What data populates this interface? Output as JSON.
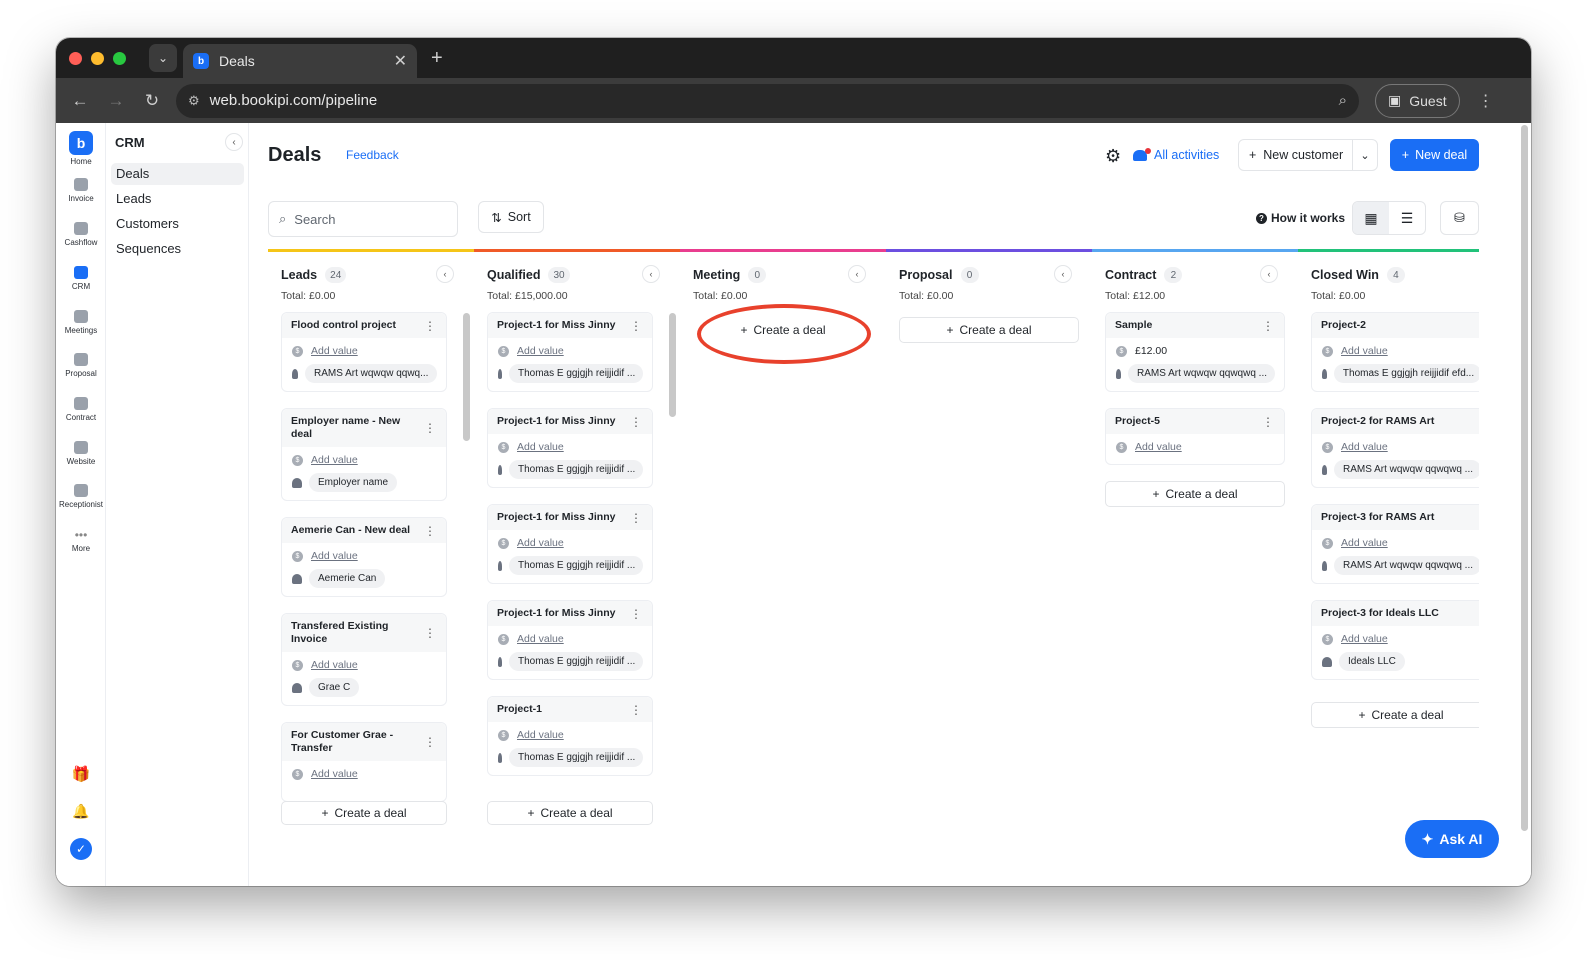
{
  "browser": {
    "tab_title": "Deals",
    "url": "web.bookipi.com/pipeline",
    "profile": "Guest"
  },
  "rail": [
    {
      "label": "Home",
      "icon": "home-logo-icon"
    },
    {
      "label": "Invoice",
      "icon": "invoice-icon"
    },
    {
      "label": "Cashflow",
      "icon": "cashflow-icon"
    },
    {
      "label": "CRM",
      "icon": "crm-icon"
    },
    {
      "label": "Meetings",
      "icon": "meetings-icon"
    },
    {
      "label": "Proposal",
      "icon": "proposal-icon"
    },
    {
      "label": "Contract",
      "icon": "contract-icon"
    },
    {
      "label": "Website",
      "icon": "website-icon"
    },
    {
      "label": "Receptionist",
      "icon": "receptionist-icon"
    },
    {
      "label": "More",
      "icon": "more-icon"
    }
  ],
  "subnav": {
    "title": "CRM",
    "items": [
      "Deals",
      "Leads",
      "Customers",
      "Sequences"
    ]
  },
  "header": {
    "title": "Deals",
    "feedback": "Feedback",
    "all_activities": "All activities",
    "new_customer": "New customer",
    "new_deal": "New deal"
  },
  "toolbar": {
    "search_placeholder": "Search",
    "sort": "Sort",
    "how_it_works": "How it works"
  },
  "colors": {
    "accent": "#1a6ef5",
    "leads": "#f5c518",
    "qualified": "#f05a28",
    "meeting": "#e93d8f",
    "proposal": "#6c4fe0",
    "contract": "#57a6f0",
    "closed_win": "#22c27a",
    "highlight": "#e8412c"
  },
  "columns": [
    {
      "name": "Leads",
      "count": "24",
      "total": "Total: £0.00",
      "cards": [
        {
          "title": "Flood control project",
          "value": "Add value",
          "who": "RAMS Art wqwqw qqwq..."
        },
        {
          "title": "Employer name - New deal",
          "value": "Add value",
          "who": "Employer name"
        },
        {
          "title": "Aemerie Can - New deal",
          "value": "Add value",
          "who": "Aemerie Can"
        },
        {
          "title": "Transfered Existing Invoice",
          "value": "Add value",
          "who": "Grae C"
        },
        {
          "title": "For Customer Grae - Transfer",
          "value": "Add value",
          "who": ""
        }
      ],
      "create": "Create a deal"
    },
    {
      "name": "Qualified",
      "count": "30",
      "total": "Total: £15,000.00",
      "cards": [
        {
          "title": "Project-1 for Miss Jinny",
          "value": "Add value",
          "who": "Thomas E ggjgjh reijjidif ..."
        },
        {
          "title": "Project-1 for Miss Jinny",
          "value": "Add value",
          "who": "Thomas E ggjgjh reijjidif ..."
        },
        {
          "title": "Project-1 for Miss Jinny",
          "value": "Add value",
          "who": "Thomas E ggjgjh reijjidif ..."
        },
        {
          "title": "Project-1 for Miss Jinny",
          "value": "Add value",
          "who": "Thomas E ggjgjh reijjidif ..."
        },
        {
          "title": "Project-1",
          "value": "Add value",
          "who": "Thomas E ggjgjh reijjidif ..."
        }
      ],
      "create": "Create a deal"
    },
    {
      "name": "Meeting",
      "count": "0",
      "total": "Total: £0.00",
      "cards": [],
      "create": "Create a deal"
    },
    {
      "name": "Proposal",
      "count": "0",
      "total": "Total: £0.00",
      "cards": [],
      "create": "Create a deal"
    },
    {
      "name": "Contract",
      "count": "2",
      "total": "Total: £12.00",
      "cards": [
        {
          "title": "Sample",
          "value": "£12.00",
          "who": "RAMS Art wqwqw qqwqwq ..."
        },
        {
          "title": "Project-5",
          "value": "Add value",
          "who": ""
        }
      ],
      "create": "Create a deal"
    },
    {
      "name": "Closed Win",
      "count": "4",
      "total": "Total: £0.00",
      "cards": [
        {
          "title": "Project-2",
          "value": "Add value",
          "who": "Thomas E ggjgjh reijjidif efd..."
        },
        {
          "title": "Project-2 for RAMS Art",
          "value": "Add value",
          "who": "RAMS Art wqwqw qqwqwq ..."
        },
        {
          "title": "Project-3 for RAMS Art",
          "value": "Add value",
          "who": "RAMS Art wqwqw qqwqwq ..."
        },
        {
          "title": "Project-3 for Ideals LLC",
          "value": "Add value",
          "who": "Ideals LLC"
        }
      ],
      "create": "Create a deal"
    }
  ],
  "ask_ai": "Ask AI"
}
